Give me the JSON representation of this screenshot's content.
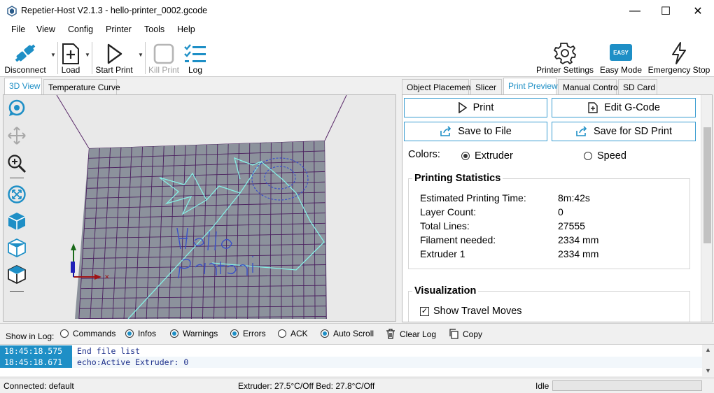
{
  "window": {
    "title": "Repetier-Host V2.1.3 - hello-printer_0002.gcode",
    "minimize": "—",
    "maximize": "☐",
    "close": "✕"
  },
  "menu": [
    "File",
    "View",
    "Config",
    "Printer",
    "Tools",
    "Help"
  ],
  "toolbar": {
    "disconnect": "Disconnect",
    "load": "Load",
    "start_print": "Start Print",
    "kill_print": "Kill Print",
    "log": "Log",
    "printer_settings": "Printer Settings",
    "easy_mode": "Easy Mode",
    "easy_badge": "EASY",
    "emergency_stop": "Emergency Stop"
  },
  "left_tabs": [
    "3D View",
    "Temperature Curve"
  ],
  "right_tabs": [
    "Object Placement",
    "Slicer",
    "Print Preview",
    "Manual Control",
    "SD Card"
  ],
  "preview": {
    "print_btn": "Print",
    "edit_gcode_btn": "Edit G-Code",
    "save_file_btn": "Save to File",
    "save_sd_btn": "Save for SD Print",
    "colors_label": "Colors:",
    "color_extruder": "Extruder",
    "color_speed": "Speed",
    "stats_title": "Printing Statistics",
    "stats": [
      {
        "label": "Estimated Printing Time:",
        "value": "8m:42s"
      },
      {
        "label": "Layer Count:",
        "value": "0"
      },
      {
        "label": "Total Lines:",
        "value": "27555"
      },
      {
        "label": "Filament needed:",
        "value": "2334 mm"
      },
      {
        "label": "Extruder 1",
        "value": "2334 mm"
      }
    ],
    "vis_title": "Visualization",
    "show_travel": "Show Travel Moves"
  },
  "log": {
    "show_label": "Show in Log:",
    "options": [
      {
        "label": "Commands",
        "checked": false
      },
      {
        "label": "Infos",
        "checked": true
      },
      {
        "label": "Warnings",
        "checked": true
      },
      {
        "label": "Errors",
        "checked": true
      },
      {
        "label": "ACK",
        "checked": false
      },
      {
        "label": "Auto Scroll",
        "checked": true
      }
    ],
    "clear_log": "Clear Log",
    "copy": "Copy",
    "entries": [
      {
        "time": "18:45:18.575",
        "text": "End file list"
      },
      {
        "time": "18:45:18.671",
        "text": "echo:Active Extruder: 0"
      }
    ]
  },
  "status": {
    "connection": "Connected: default",
    "temps": "Extruder: 27.5°C/Off Bed: 27.8°C/Off",
    "state": "Idle"
  },
  "colors": {
    "accent": "#1e8fc6",
    "bed": "#8c929c",
    "path": "#86f0e6",
    "text_path": "#3a4fc7"
  }
}
